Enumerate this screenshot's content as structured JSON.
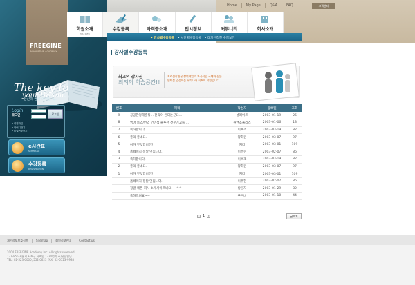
{
  "util_nav": {
    "items": [
      "Home",
      "My Page",
      "Q&A",
      "FAQ"
    ],
    "lang_button": "고객센터"
  },
  "brand": {
    "name": "FREEGINE",
    "tagline": "INNOVATIVE ACADEMY"
  },
  "slogan": {
    "line1": "The key to",
    "line2": "your Dream.",
    "ko": "당신의 꿈을 이루는 곳.."
  },
  "login": {
    "title": "Login",
    "subtitle": "로그인",
    "button": "로그인",
    "links": [
      "• 회원가입",
      "• 아이디찾기",
      "• 비밀번호찾기"
    ]
  },
  "side_buttons": [
    {
      "label": "e시간표",
      "sub": "SCHEDULE"
    },
    {
      "label": "수강등록",
      "sub": "REGISTRATION"
    }
  ],
  "nav": {
    "items": [
      {
        "label": "학원소개",
        "sub": "EDU INFO",
        "icon": "book-icon"
      },
      {
        "label": "수강등록",
        "sub": "REGISTRATION",
        "icon": "pen-book-icon",
        "active": true
      },
      {
        "label": "자격증소개",
        "sub": "REQUIREMENT INFO",
        "icon": "certificate-icon"
      },
      {
        "label": "입시정보",
        "sub": "EXAM INFO",
        "icon": "pencil-icon"
      },
      {
        "label": "커뮤니티",
        "sub": "COMMUNITY",
        "icon": "people-icon"
      },
      {
        "label": "회사소개",
        "sub": "COMPANY INFO",
        "icon": "building-icon"
      }
    ],
    "subnav": [
      "• 강사별수강등록",
      "• 시간별수강등록",
      "• 대기신청한 수강보기"
    ]
  },
  "page_title": "강사별수강등록",
  "banner": {
    "title": "최고의 강사진",
    "subtitle": "최적의 학습공간!!",
    "desc1": "프리진학원은 창의력있고 자극적인 국제화 전문",
    "desc2": "인재를 양성하는 우리나라 최초의 학원입니다."
  },
  "table": {
    "headers": [
      "번호",
      "제목",
      "작성자",
      "등록일",
      "조회"
    ],
    "rows": [
      [
        "9",
        "공공한정해준뭐....전략이 안되는군요...",
        "셀레이트",
        "2003-01-19",
        "26"
      ],
      [
        "8",
        "영어 동역/번역 언어적 솔루션 전문기고를 ...",
        "원앤소울리스",
        "2003-01-06",
        "13"
      ],
      [
        "7",
        "축하합니다.",
        "이쁘조",
        "2003-03-19",
        "82"
      ],
      [
        "6",
        "좋의 좋네요.",
        "양화원",
        "2003-03-07",
        "97"
      ],
      [
        "5",
        "이거 무엇입니까?",
        "지티",
        "2003-03-01",
        "109"
      ],
      [
        "4",
        "홈페이지 정말 멋집니다.",
        "이주현",
        "2003-02-07",
        "86"
      ],
      [
        "3",
        "축하합니다.",
        "이쁘조",
        "2003-03-19",
        "82"
      ],
      [
        "2",
        "좋의 좋네요.",
        "양화원",
        "2003-03-07",
        "97"
      ],
      [
        "1",
        "이거 무엇입니까?",
        "지티",
        "2003-03-01",
        "109"
      ],
      [
        "",
        "홈페이지 정말 멋집니다.",
        "이주현",
        "2003-02-07",
        "86"
      ],
      [
        "",
        "정말 예쁜 회사 소개사이트네요~~^^",
        "방문자",
        "2003-01-29",
        "82"
      ],
      [
        "",
        "축하드려요~~",
        "푸른바",
        "2003-01-10",
        "44"
      ]
    ]
  },
  "pager": {
    "prev": "«",
    "current": "1",
    "next": "»"
  },
  "write_button": "글쓰기",
  "footer": {
    "links": [
      "개인정보보호정책",
      "Sitemap",
      "회원정보안내",
      "Contact us"
    ],
    "info": [
      "2004 FREEGINE Academy Inc. All rights reserved.",
      "137-855 서울시 서초구 서초동 1334번지 주)유진빌딩",
      "TEL: 02-523-0000, 552-0623   FAX: 02-5523-9988"
    ]
  },
  "colors": {
    "accent": "#2a7fa3",
    "brand_tan": "#a08d74",
    "left_bg": "#17485a"
  }
}
